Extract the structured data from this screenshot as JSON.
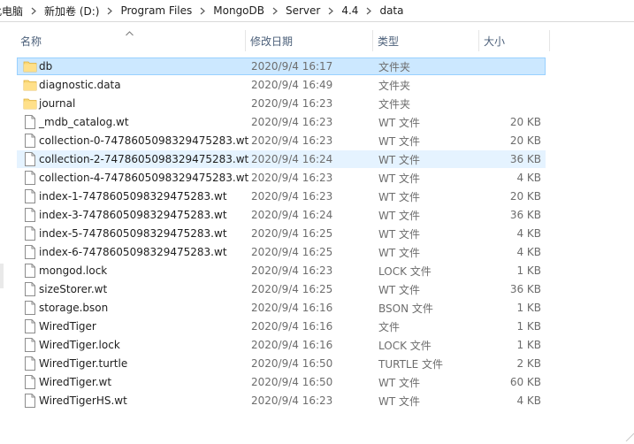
{
  "breadcrumb": [
    {
      "label": "此电脑"
    },
    {
      "label": "新加卷 (D:)"
    },
    {
      "label": "Program Files"
    },
    {
      "label": "MongoDB"
    },
    {
      "label": "Server"
    },
    {
      "label": "4.4"
    },
    {
      "label": "data"
    }
  ],
  "columns": {
    "name": "名称",
    "date": "修改日期",
    "type": "类型",
    "size": "大小"
  },
  "files": [
    {
      "name": "db",
      "date": "2020/9/4 16:17",
      "type": "文件夹",
      "size": "",
      "icon": "folder-icon"
    },
    {
      "name": "diagnostic.data",
      "date": "2020/9/4 16:49",
      "type": "文件夹",
      "size": "",
      "icon": "folder-icon"
    },
    {
      "name": "journal",
      "date": "2020/9/4 16:23",
      "type": "文件夹",
      "size": "",
      "icon": "folder-icon"
    },
    {
      "name": "_mdb_catalog.wt",
      "date": "2020/9/4 16:23",
      "type": "WT 文件",
      "size": "20 KB",
      "icon": "file-icon"
    },
    {
      "name": "collection-0-7478605098329475283.wt",
      "date": "2020/9/4 16:23",
      "type": "WT 文件",
      "size": "20 KB",
      "icon": "file-icon"
    },
    {
      "name": "collection-2-7478605098329475283.wt",
      "date": "2020/9/4 16:24",
      "type": "WT 文件",
      "size": "36 KB",
      "icon": "file-icon"
    },
    {
      "name": "collection-4-7478605098329475283.wt",
      "date": "2020/9/4 16:23",
      "type": "WT 文件",
      "size": "4 KB",
      "icon": "file-icon"
    },
    {
      "name": "index-1-7478605098329475283.wt",
      "date": "2020/9/4 16:23",
      "type": "WT 文件",
      "size": "20 KB",
      "icon": "file-icon"
    },
    {
      "name": "index-3-7478605098329475283.wt",
      "date": "2020/9/4 16:24",
      "type": "WT 文件",
      "size": "36 KB",
      "icon": "file-icon"
    },
    {
      "name": "index-5-7478605098329475283.wt",
      "date": "2020/9/4 16:25",
      "type": "WT 文件",
      "size": "4 KB",
      "icon": "file-icon"
    },
    {
      "name": "index-6-7478605098329475283.wt",
      "date": "2020/9/4 16:25",
      "type": "WT 文件",
      "size": "4 KB",
      "icon": "file-icon"
    },
    {
      "name": "mongod.lock",
      "date": "2020/9/4 16:23",
      "type": "LOCK 文件",
      "size": "1 KB",
      "icon": "file-icon"
    },
    {
      "name": "sizeStorer.wt",
      "date": "2020/9/4 16:25",
      "type": "WT 文件",
      "size": "36 KB",
      "icon": "file-icon"
    },
    {
      "name": "storage.bson",
      "date": "2020/9/4 16:16",
      "type": "BSON 文件",
      "size": "1 KB",
      "icon": "file-icon"
    },
    {
      "name": "WiredTiger",
      "date": "2020/9/4 16:16",
      "type": "文件",
      "size": "1 KB",
      "icon": "file-icon"
    },
    {
      "name": "WiredTiger.lock",
      "date": "2020/9/4 16:16",
      "type": "LOCK 文件",
      "size": "1 KB",
      "icon": "file-icon"
    },
    {
      "name": "WiredTiger.turtle",
      "date": "2020/9/4 16:50",
      "type": "TURTLE 文件",
      "size": "2 KB",
      "icon": "file-icon"
    },
    {
      "name": "WiredTiger.wt",
      "date": "2020/9/4 16:50",
      "type": "WT 文件",
      "size": "60 KB",
      "icon": "file-icon"
    },
    {
      "name": "WiredTigerHS.wt",
      "date": "2020/9/4 16:23",
      "type": "WT 文件",
      "size": "4 KB",
      "icon": "file-icon"
    }
  ],
  "selected_index": 0,
  "hover_index": 5,
  "colors": {
    "selected_bg": "#cce8ff",
    "selected_border": "#99d1ff",
    "hover_bg": "#e5f3ff",
    "folder": "#f8d775",
    "header_text": "#4c607a"
  }
}
